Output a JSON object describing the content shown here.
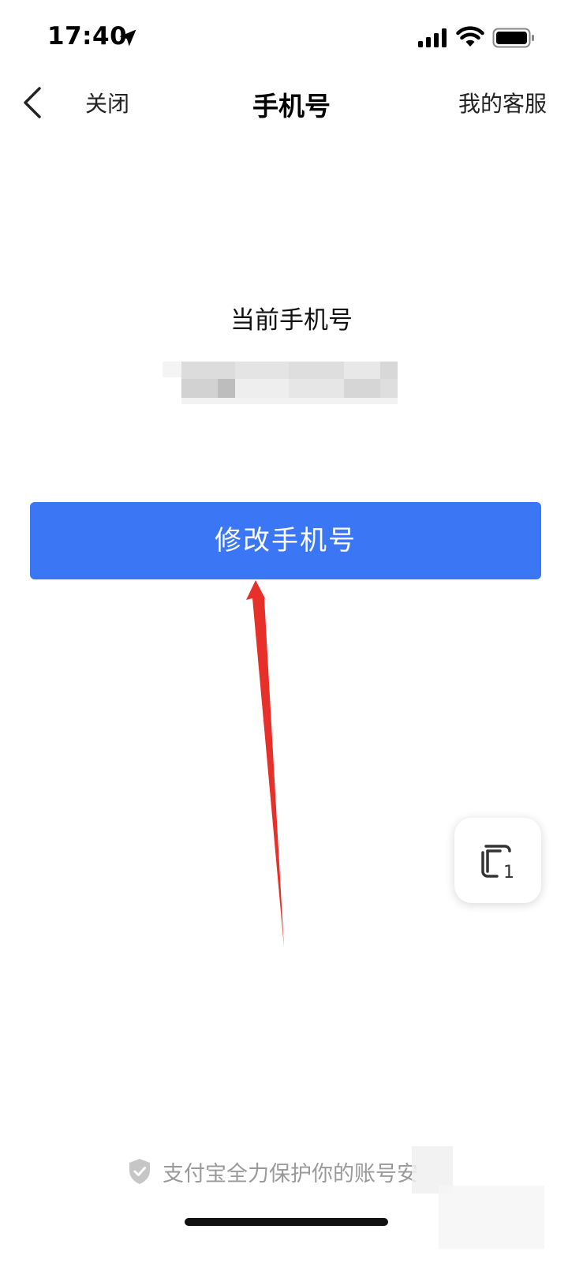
{
  "status_bar": {
    "time": "17:40",
    "icons": [
      "location-arrow-icon",
      "signal-icon",
      "wifi-icon",
      "battery-icon"
    ]
  },
  "nav": {
    "back_icon": "chevron-left-icon",
    "close_label": "关闭",
    "title": "手机号",
    "service_label": "我的客服"
  },
  "main": {
    "current_phone_label": "当前手机号",
    "modify_button_label": "修改手机号"
  },
  "floating_button": {
    "icon": "window-stack-icon",
    "count": "1"
  },
  "footer": {
    "security_text": "支付宝全力保护你的账号安",
    "icon": "shield-check-icon"
  },
  "colors": {
    "primary_button": "#3b77f4",
    "arrow_annotation": "#e8302a",
    "footer_text": "#9a9a9a"
  }
}
